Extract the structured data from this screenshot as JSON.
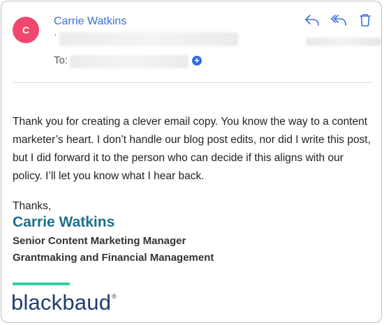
{
  "email": {
    "avatar_initial": "C",
    "sender_name": "Carrie Watkins",
    "to_label": "To:",
    "body": "Thank you for creating a clever email copy. You know the way to a content marketer’s heart. I don’t handle our blog post edits, nor did I write this post, but I did forward it to the person who can decide if this aligns with our policy. I’ll let you know what I hear back."
  },
  "signature": {
    "closing": "Thanks,",
    "name": "Carrie Watkins",
    "title": "Senior Content Marketing Manager",
    "department": "Grantmaking and Financial Management",
    "logo_text": "blackbaud"
  },
  "colors": {
    "avatar_bg": "#f0476e",
    "link_blue": "#3a6fd8",
    "signature_teal": "#1f6e8c",
    "logo_accent": "#2fd1a3",
    "logo_navy": "#1f3e6e"
  },
  "icons": {
    "reply": "reply-icon",
    "reply_all": "reply-all-icon",
    "delete": "trash-icon",
    "add_recipient": "plus-circle-icon"
  }
}
